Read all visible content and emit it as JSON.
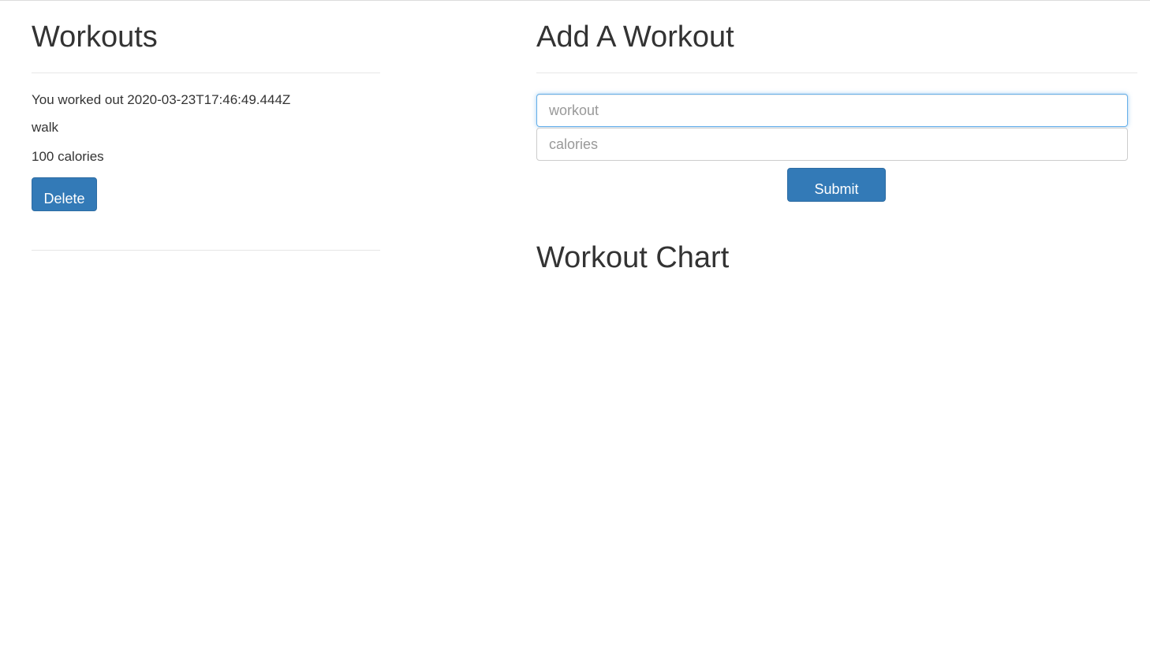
{
  "workouts_panel": {
    "title": "Workouts",
    "entries": [
      {
        "date_line": "You worked out 2020-03-23T17:46:49.444Z",
        "name": "walk",
        "calories_line": "100 calories",
        "delete_label": "Delete"
      }
    ]
  },
  "add_panel": {
    "title": "Add A Workout",
    "workout_field": {
      "placeholder": "workout",
      "value": ""
    },
    "calories_field": {
      "placeholder": "calories",
      "value": ""
    },
    "submit_label": "Submit"
  },
  "chart_panel": {
    "title": "Workout Chart"
  },
  "colors": {
    "primary_button": "#337ab7",
    "focus_border": "#66afe9"
  }
}
